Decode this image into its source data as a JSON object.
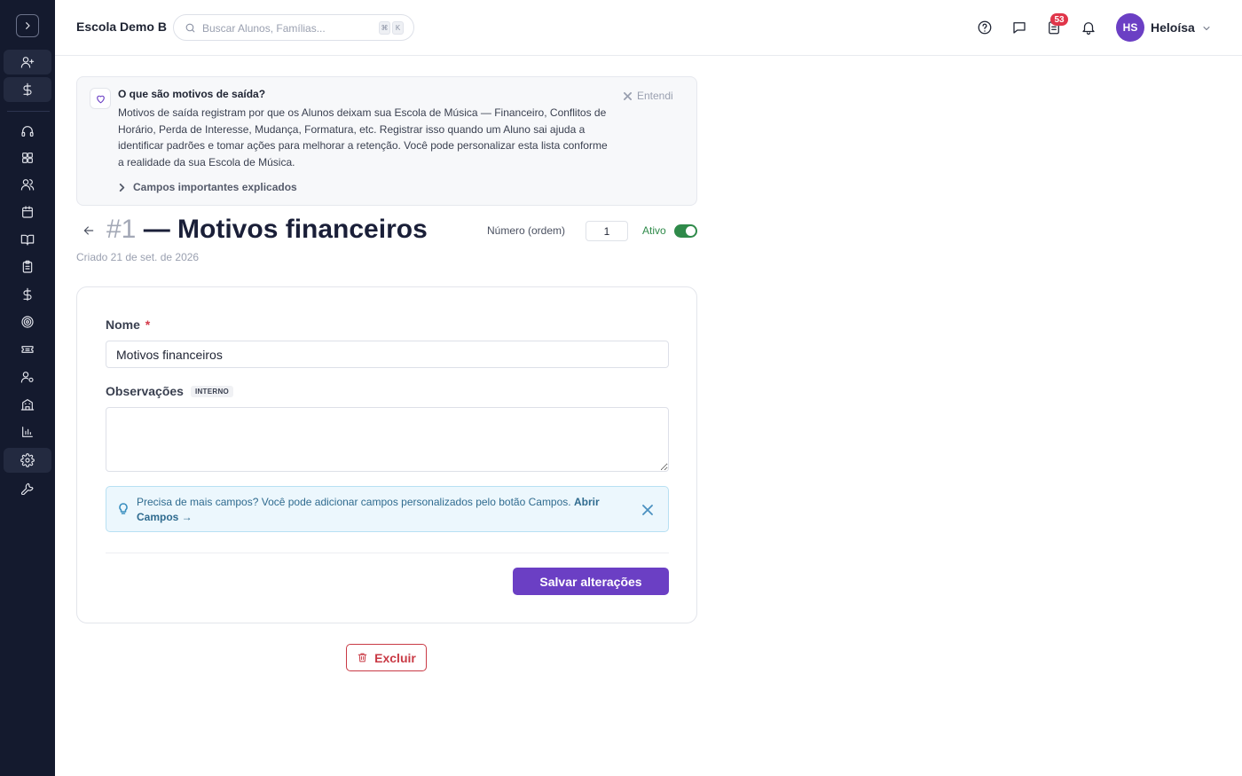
{
  "header": {
    "school_name": "Escola Demo B",
    "search_placeholder": "Buscar Alunos, Famílias...",
    "shortcut_keys": [
      "⌘",
      "K"
    ],
    "tasks_badge": "53",
    "user": {
      "initials": "HS",
      "name": "Heloísa"
    }
  },
  "sidebar": {
    "icons": [
      "chevron-right-icon",
      "user-plus-icon",
      "dollar-icon",
      "headset-icon",
      "dashboard-icon",
      "users-icon",
      "calendar-icon",
      "book-icon",
      "clipboard-icon",
      "dollar-icon",
      "target-icon",
      "ticket-icon",
      "user-settings-icon",
      "building-icon",
      "bar-chart-icon",
      "settings-icon",
      "wrench-icon"
    ],
    "active_item": "settings"
  },
  "info_card": {
    "title": "O que são motivos de saída?",
    "body": "Motivos de saída registram por que os Alunos deixam sua Escola de Música — Financeiro, Conflitos de Horário, Perda de Interesse, Mudança, Formatura, etc. Registrar isso quando um Aluno sai ajuda a identificar padrões e tomar ações para melhorar a retenção. Você pode personalizar esta lista conforme a realidade da sua Escola de Música.",
    "dismiss_label": "Entendi",
    "expand_label": "Campos importantes explicados"
  },
  "record": {
    "number_prefix": "#1",
    "title_rest": " — Motivos financeiros",
    "created": "Criado 21 de set. de 2026",
    "order_label": "Número (ordem)",
    "order_value": "1",
    "active_label": "Ativo",
    "active": true
  },
  "form": {
    "name_label": "Nome",
    "required_marker": "*",
    "name_value": "Motivos financeiros",
    "obs_label": "Observações",
    "obs_badge": "INTERNO",
    "obs_value": "",
    "tip_text": "Precisa de mais campos? Você pode adicionar campos personalizados pelo botão Campos. ",
    "tip_link": "Abrir Campos →",
    "save_label": "Salvar alterações"
  },
  "actions": {
    "delete_label": "Excluir"
  },
  "colors": {
    "sidebar_bg": "#141a2e",
    "accent": "#6b3fc4",
    "active_green": "#2f8a4a",
    "danger": "#c93a45",
    "badge_red": "#e0364a",
    "tip_bg": "#ecf7fd"
  }
}
